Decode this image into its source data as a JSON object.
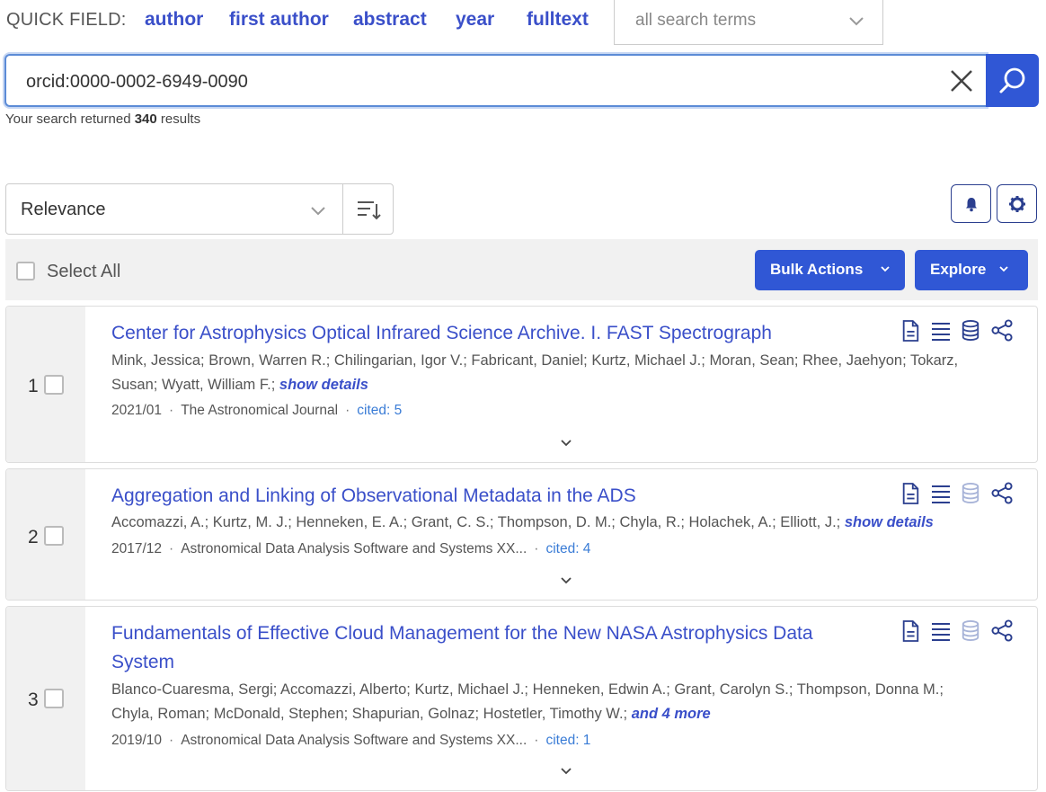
{
  "quick_field": {
    "label": "QUICK FIELD:",
    "links": [
      "author",
      "first author",
      "abstract",
      "year",
      "fulltext"
    ],
    "terms_placeholder": "all search terms"
  },
  "search": {
    "value": "orcid:0000-0002-6949-0090",
    "result_prefix": "Your search returned ",
    "result_count": "340",
    "result_suffix": " results"
  },
  "sort": {
    "selected": "Relevance"
  },
  "toolbar": {
    "select_all": "Select All",
    "bulk_actions": "Bulk Actions",
    "explore": "Explore"
  },
  "colors": {
    "accent": "#3057d5",
    "link": "#3a4fc9",
    "cited": "#3a7cd6"
  },
  "results": [
    {
      "index": "1",
      "title_lines": [
        "Center for Astrophysics Optical Infrared Science Archive. I. FAST Spectrograph"
      ],
      "authors_lines": [
        "Mink, Jessica; Brown, Warren R.; Chilingarian, Igor V.; Fabricant, Daniel; Kurtz, Michael J.; Moran, Sean; Rhee, Jaehyon; Tokarz,",
        "Susan; Wyatt, William F.; "
      ],
      "more": "show details",
      "date": "2021/01",
      "pub": "The Astronomical Journal",
      "cited": "cited: 5",
      "data_available": true
    },
    {
      "index": "2",
      "title_lines": [
        "Aggregation and Linking of Observational Metadata in the ADS"
      ],
      "authors_lines": [
        "Accomazzi, A.; Kurtz, M. J.; Henneken, E. A.; Grant, C. S.; Thompson, D. M.; Chyla, R.; Holachek, A.; Elliott, J.; "
      ],
      "more": "show details",
      "date": "2017/12",
      "pub": "Astronomical Data Analysis Software and Systems XX...",
      "cited": "cited: 4",
      "data_available": false
    },
    {
      "index": "3",
      "title_lines": [
        "Fundamentals of Effective Cloud Management for the New NASA Astrophysics Data",
        "System"
      ],
      "authors_lines": [
        "Blanco-Cuaresma, Sergi; Accomazzi, Alberto; Kurtz, Michael J.; Henneken, Edwin A.; Grant, Carolyn S.; Thompson, Donna M.;",
        "Chyla, Roman; McDonald, Stephen; Shapurian, Golnaz; Hostetler, Timothy W.; "
      ],
      "more": "and 4 more",
      "date": "2019/10",
      "pub": "Astronomical Data Analysis Software and Systems XX...",
      "cited": "cited: 1",
      "data_available": false
    }
  ]
}
